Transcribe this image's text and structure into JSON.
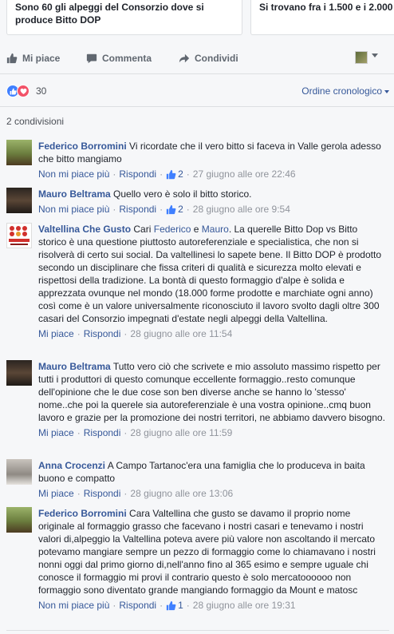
{
  "cards": [
    {
      "title": "Sono 60 gli alpeggi del Consorzio dove si\nproduce Bitto DOP"
    },
    {
      "title": "Si trovano fra i 1.500 e i 2.000"
    }
  ],
  "actions": {
    "like": "Mi piace",
    "comment": "Commenta",
    "share": "Condividi"
  },
  "reactions": {
    "count": "30",
    "sort_label": "Ordine cronologico"
  },
  "shares_label": "2 condivisioni",
  "comments": [
    {
      "author": "Federico Borromini",
      "text": "Vi ricordate che il vero bitto si faceva in Valle gerola adesso che bitto mangiamo",
      "action": "Non mi piace più",
      "reply": "Rispondi",
      "likes": "2",
      "time": "27 giugno alle ore 22:46"
    },
    {
      "author": "Mauro Beltrama",
      "text": "Quello vero è solo il bitto storico.",
      "action": "Non mi piace più",
      "reply": "Rispondi",
      "likes": "2",
      "time": "28 giugno alle ore 9:54"
    },
    {
      "author": "Valtellina Che Gusto",
      "pre": "Cari",
      "mention1": "Federico",
      "mid": "e",
      "mention2": "Mauro",
      "text": ". La querelle Bitto Dop vs Bitto storico è una questione piuttosto autoreferenziale e specialistica, che non si risolverà di certo sui social. Da valtellinesi lo sapete bene. Il Bitto DOP è prodotto secondo un disciplinare che fissa criteri di qualità e sicurezza molto elevati e rispettosi della tradizione. La bontà di questo formaggio d'alpe è solida e apprezzata ovunque nel mondo (18.000 forme prodotte e marchiate ogni anno) così come è un valore universalmente riconosciuto il lavoro svolto dagli oltre 300 casari del Consorzio impegnati d'estate negli alpeggi della Valtellina.",
      "action": "Mi piace",
      "reply": "Rispondi",
      "time": "28 giugno alle ore 11:54"
    },
    {
      "author": "Mauro Beltrama",
      "text": "Tutto vero ciò che scrivete e mio assoluto massimo rispetto per tutti i produttori di questo comunque eccellente formaggio..resto comunque dell'opinione che le due cose son ben diverse anche se hanno lo 'stesso' nome..che poi la querele sia autoreferenziale è una vostra opinione..cmq buon lavoro e grazie per la promozione dei nostri territori, ne abbiamo davvero bisogno.",
      "action": "Mi piace",
      "reply": "Rispondi",
      "time": "28 giugno alle ore 11:59"
    },
    {
      "author": "Anna Crocenzi",
      "text": "A Campo Tartanoc'era una famiglia che lo produceva in baita buono e compatto",
      "action": "Mi piace",
      "reply": "Rispondi",
      "time": "28 giugno alle ore 13:06"
    },
    {
      "author": "Federico Borromini",
      "text": "Cara Valtellina che gusto se davamo il proprio nome originale al formaggio grasso che facevano i nostri casari e tenevamo i nostri valori di,alpeggio la Valtellina poteva avere più valore non ascoltando il mercato potevamo mangiare sempre un pezzo di formaggio come lo chiamavano i nostri nonni oggi dal primo giorno di,nell'anno fino al 365 esimo e sempre uguale chi conosce il formaggio mi provi il contrario questo è solo mercatoooooo non formaggio sono diventato grande mangiando formaggio da Mount e matosc",
      "action": "Non mi piace più",
      "reply": "Rispondi",
      "likes": "1",
      "time": "28 giugno alle ore 19:31"
    }
  ],
  "avatar_logo": "Valtellina Che Gusto",
  "icons": {
    "like": "thumbs-up-icon",
    "comment": "speech-bubble-icon",
    "share": "share-arrow-icon",
    "love": "heart-icon"
  },
  "colors": {
    "link": "#365899",
    "like_blue": "#4080ff",
    "love_red": "#f25268",
    "meta_gray": "#90949c"
  }
}
